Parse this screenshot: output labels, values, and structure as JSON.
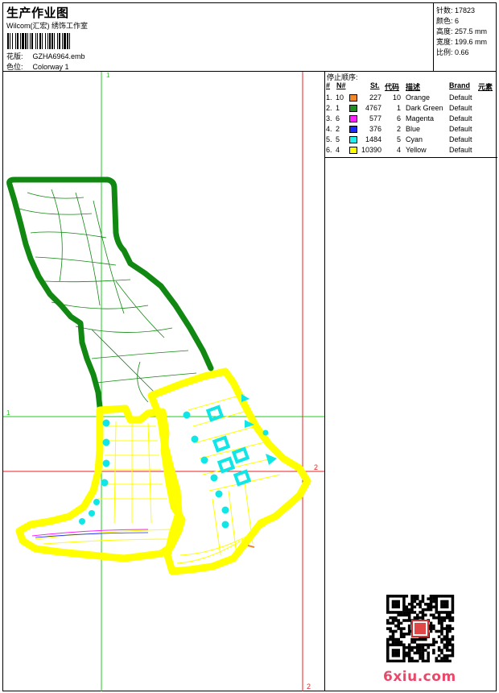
{
  "header": {
    "title": "生产作业图",
    "subtitle": "Wilcom(汇宏) 绣饰工作室",
    "design_label": "花版:",
    "design_value": "GZHA6964.emb",
    "colorway_label": "色位:",
    "colorway_value": "Colorway 1"
  },
  "stats": [
    {
      "label": "针数:",
      "value": "17823"
    },
    {
      "label": "颜色:",
      "value": "6"
    },
    {
      "label": "高度:",
      "value": "257.5 mm"
    },
    {
      "label": "宽度:",
      "value": "199.6 mm"
    },
    {
      "label": "比例:",
      "value": "0.66"
    }
  ],
  "canvas": {
    "guide_v1_label": "1",
    "guide_h1_label": "1",
    "guide_h2_label": "2",
    "guide_v2_label": "2"
  },
  "stop_sequence": {
    "title": "停止顺序:",
    "columns": {
      "num": "#",
      "n": "N#",
      "st": "St.",
      "code": "代码",
      "desc": "描述",
      "brand": "Brand",
      "elem": "元素"
    },
    "rows": [
      {
        "num": "1.",
        "n": "10",
        "color": "#f0882a",
        "st": "227",
        "code": "10",
        "desc": "Orange",
        "brand": "Default"
      },
      {
        "num": "2.",
        "n": "1",
        "color": "#1f8f1f",
        "st": "4767",
        "code": "1",
        "desc": "Dark Green",
        "brand": "Default"
      },
      {
        "num": "3.",
        "n": "6",
        "color": "#ff22ff",
        "st": "577",
        "code": "6",
        "desc": "Magenta",
        "brand": "Default"
      },
      {
        "num": "4.",
        "n": "2",
        "color": "#1a2aff",
        "st": "376",
        "code": "2",
        "desc": "Blue",
        "brand": "Default"
      },
      {
        "num": "5.",
        "n": "5",
        "color": "#22eeee",
        "st": "1484",
        "code": "5",
        "desc": "Cyan",
        "brand": "Default"
      },
      {
        "num": "6.",
        "n": "4",
        "color": "#ffff00",
        "st": "10390",
        "code": "4",
        "desc": "Yellow",
        "brand": "Default"
      }
    ]
  },
  "watermark": {
    "text": "6xiu.com"
  },
  "colors": {
    "green_thread": "#118811",
    "yellow_thread": "#ffff00",
    "cyan_thread": "#11e6e6",
    "guide_green": "#22cc22",
    "guide_red": "#ee2222"
  }
}
